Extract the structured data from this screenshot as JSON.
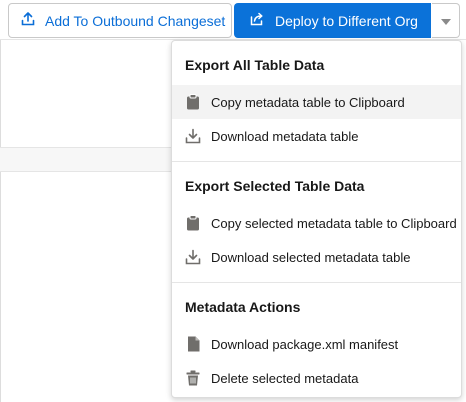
{
  "toolbar": {
    "outbound_label": "Add To Outbound Changeset",
    "deploy_label": "Deploy to Different Org"
  },
  "dropdown": {
    "sections": [
      {
        "title": "Export All Table Data",
        "items": [
          {
            "label": "Copy metadata table to Clipboard",
            "icon": "clipboard-icon"
          },
          {
            "label": "Download metadata table",
            "icon": "download-icon"
          }
        ]
      },
      {
        "title": "Export Selected Table Data",
        "items": [
          {
            "label": "Copy selected metadata table to Clipboard",
            "icon": "clipboard-icon"
          },
          {
            "label": "Download selected metadata table",
            "icon": "download-icon"
          }
        ]
      },
      {
        "title": "Metadata Actions",
        "items": [
          {
            "label": "Download package.xml manifest",
            "icon": "file-icon"
          },
          {
            "label": "Delete selected metadata",
            "icon": "trash-icon"
          }
        ]
      }
    ]
  },
  "colors": {
    "brand": "#0b72d9",
    "link": "#0b6ed7",
    "icon": "#706e6b"
  }
}
